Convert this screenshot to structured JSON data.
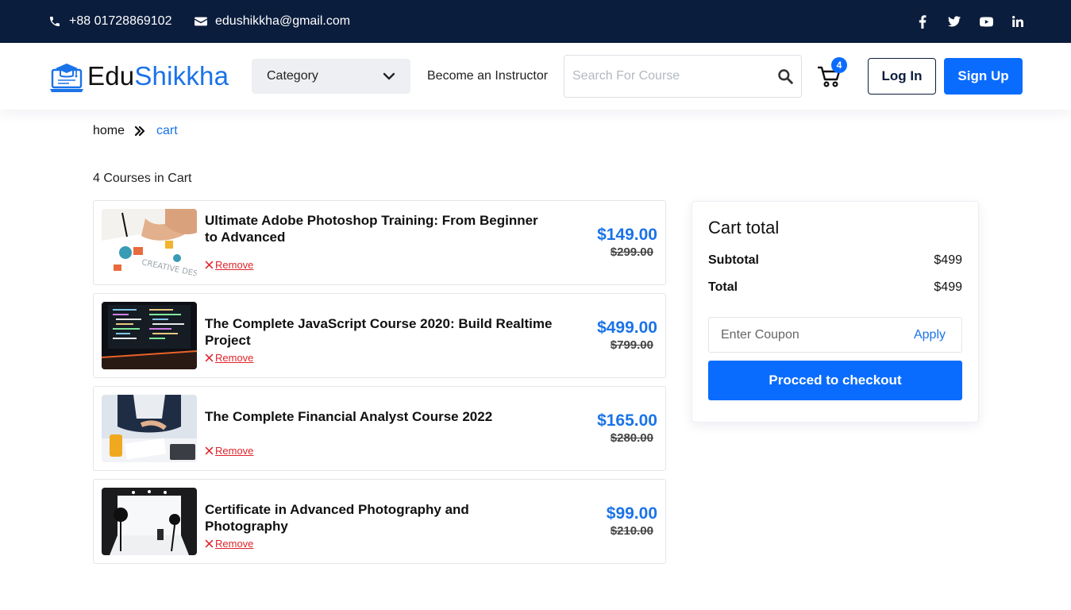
{
  "topbar": {
    "phone": "+88 01728869102",
    "email": "edushikkha@gmail.com",
    "social": [
      "facebook-icon",
      "twitter-icon",
      "youtube-icon",
      "linkedin-icon"
    ]
  },
  "header": {
    "logo_part1": "Edu",
    "logo_part2": "Shikkha",
    "category_label": "Category",
    "become_instructor": "Become an Instructor",
    "search_placeholder": "Search For Course",
    "cart_count": "4",
    "login_label": "Log In",
    "signup_label": "Sign Up"
  },
  "breadcrumb": {
    "home": "home",
    "current": "cart"
  },
  "cart": {
    "count_text": "4 Courses in Cart",
    "remove_label": "Remove",
    "items": [
      {
        "title": "Ultimate Adobe Photoshop Training: From Beginner to Advanced",
        "price": "$149.00",
        "old_price": "$299.00"
      },
      {
        "title": "The Complete JavaScript Course 2020: Build Realtime Project",
        "price": "$499.00",
        "old_price": "$799.00"
      },
      {
        "title": "The Complete Financial Analyst Course 2022",
        "price": "$165.00",
        "old_price": "$280.00"
      },
      {
        "title": "Certificate in Advanced Photography and Photography",
        "price": "$99.00",
        "old_price": "$210.00"
      }
    ]
  },
  "summary": {
    "title": "Cart total",
    "subtotal_label": "Subtotal",
    "subtotal_value": "$499",
    "total_label": "Total",
    "total_value": "$499",
    "coupon_placeholder": "Enter Coupon",
    "apply_label": "Apply",
    "checkout_label": "Procced to checkout"
  },
  "colors": {
    "topbar": "#0b1d3d",
    "accent": "#0a6cff",
    "link": "#1a73e8",
    "remove": "#e0242a"
  }
}
